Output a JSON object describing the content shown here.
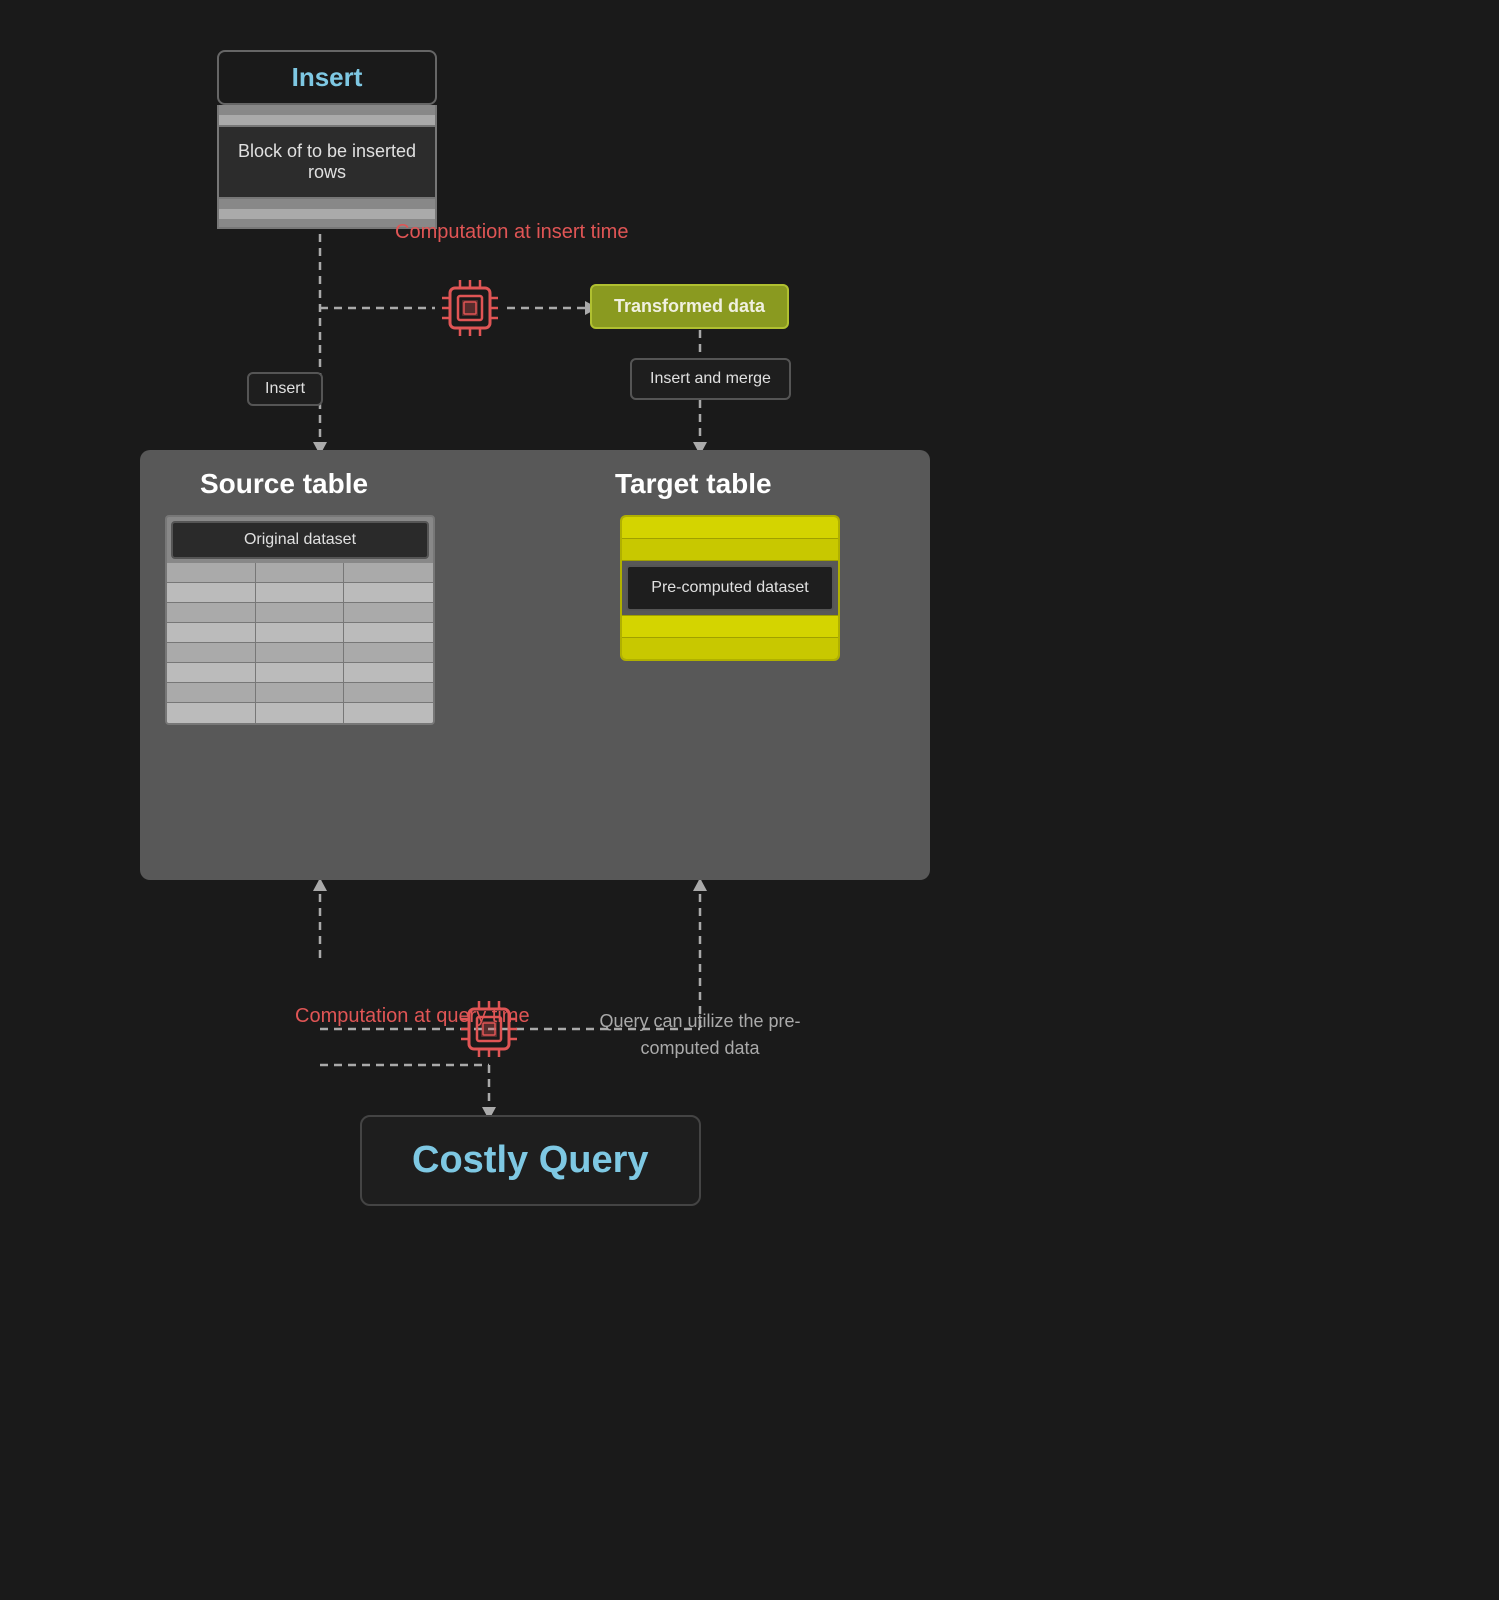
{
  "nodes": {
    "insert_top_label": "Insert",
    "block_rows_label": "Block of to be\ninserted rows",
    "computation_insert_label": "Computation\nat insert time",
    "transformed_data_label": "Transformed data",
    "insert_merge_label": "Insert\nand merge",
    "insert_small_label": "Insert",
    "source_table_label": "Source table",
    "target_table_label": "Target table",
    "original_dataset_label": "Original dataset",
    "pre_computed_label": "Pre-computed\ndataset",
    "computation_query_label": "Computation\nat query time",
    "query_utilize_label": "Query can utilize the\npre-computed data",
    "costly_query_label": "Costly Query"
  },
  "colors": {
    "background": "#1a1a1a",
    "blue_text": "#7ec8e3",
    "red_text": "#e05555",
    "gray_text": "#aaaaaa",
    "white_text": "#ffffff",
    "node_bg": "#1e1e1e",
    "node_border": "#555555",
    "yellow_bg": "#d4d400",
    "yellow_border": "#b0c030",
    "olive_bg": "#8a9a20",
    "db_area_bg": "#555555",
    "source_grid_bg": "#aaaaaa",
    "dashed_line_color": "#aaaaaa"
  }
}
